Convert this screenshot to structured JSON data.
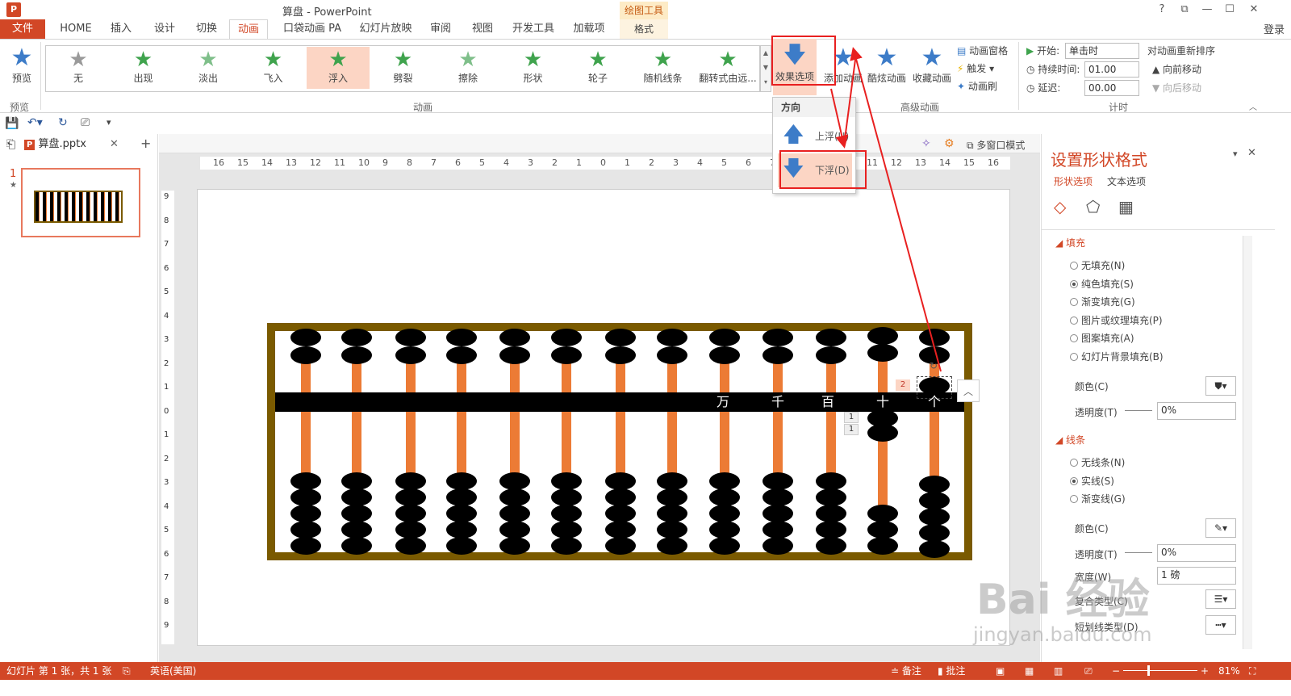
{
  "window": {
    "title": "算盘 - PowerPoint",
    "app_icon": "P",
    "help": "?",
    "restore": "⧉",
    "minimize": "—",
    "maximize": "☐",
    "close": "✕",
    "login": "登录"
  },
  "contextual": {
    "header": "绘图工具",
    "tab": "格式"
  },
  "tabs": [
    "文件",
    "HOME",
    "插入",
    "设计",
    "切换",
    "动画",
    "口袋动画 PA",
    "幻灯片放映",
    "审阅",
    "视图",
    "开发工具",
    "加载项"
  ],
  "ribbon": {
    "preview": {
      "label": "预览",
      "group": "预览"
    },
    "gallery": [
      "无",
      "出现",
      "淡出",
      "飞入",
      "浮入",
      "劈裂",
      "擦除",
      "形状",
      "轮子",
      "随机线条",
      "翻转式由远..."
    ],
    "gallery_selected": "浮入",
    "group_animation": "动画",
    "effect_options": "效果选项",
    "add_animation": "添加动画",
    "animation_painter_big": "酷炫动画",
    "collect_animation": "收藏动画",
    "animation_pane": "动画窗格",
    "trigger": "触发",
    "animation_brush": "动画刷",
    "group_advanced": "高级动画",
    "start_label": "开始:",
    "start_value": "单击时",
    "duration_label": "持续时间:",
    "duration_value": "01.00",
    "delay_label": "延迟:",
    "delay_value": "00.00",
    "reorder_title": "对动画重新排序",
    "move_earlier": "向前移动",
    "move_later": "向后移动",
    "group_timing": "计时"
  },
  "dropdown": {
    "header": "方向",
    "up": "上浮(U)",
    "down": "下浮(D)"
  },
  "file_tab": {
    "name": "算盘.pptx",
    "close": "✕",
    "add": "+"
  },
  "multiwindow": "多窗口模式",
  "slide_pane": {
    "number": "1",
    "star": "★"
  },
  "ruler_h": [
    "16",
    "15",
    "14",
    "13",
    "12",
    "11",
    "10",
    "9",
    "8",
    "7",
    "6",
    "5",
    "4",
    "3",
    "2",
    "1",
    "0",
    "1",
    "2",
    "3",
    "4",
    "5",
    "6",
    "7",
    "8",
    "9",
    "10",
    "11",
    "12",
    "13",
    "14",
    "15",
    "16"
  ],
  "ruler_v": [
    "9",
    "8",
    "7",
    "6",
    "5",
    "4",
    "3",
    "2",
    "1",
    "0",
    "1",
    "2",
    "3",
    "4",
    "5",
    "6",
    "7",
    "8",
    "9"
  ],
  "abacus": {
    "digits": [
      "万",
      "千",
      "百",
      "十",
      "个"
    ],
    "anim_tag_selected": "2",
    "anim_tags": [
      "1",
      "1"
    ],
    "collapse": "︿"
  },
  "format_pane": {
    "title": "设置形状格式",
    "tabs": [
      "形状选项",
      "文本选项"
    ],
    "fill_header": "填充",
    "fill_options": [
      "无填充(N)",
      "纯色填充(S)",
      "渐变填充(G)",
      "图片或纹理填充(P)",
      "图案填充(A)",
      "幻灯片背景填充(B)"
    ],
    "fill_selected": "纯色填充(S)",
    "color_label": "颜色(C)",
    "transparency_label": "透明度(T)",
    "transparency_value": "0%",
    "line_header": "线条",
    "line_options": [
      "无线条(N)",
      "实线(S)",
      "渐变线(G)"
    ],
    "line_selected": "实线(S)",
    "line_color_label": "颜色(C)",
    "line_transparency_label": "透明度(T)",
    "line_transparency_value": "0%",
    "width_label": "宽度(W)",
    "width_value": "1 磅",
    "compound_label": "复合类型(C)",
    "dash_label": "短划线类型(D)",
    "pin": "▾",
    "close": "✕"
  },
  "status": {
    "slide": "幻灯片 第 1 张，共 1 张",
    "language": "英语(美国)",
    "notes": "备注",
    "comments": "批注",
    "zoom": "81%",
    "zoom_minus": "−",
    "zoom_plus": "+"
  },
  "watermark": {
    "main": "Bai 经验",
    "sub": "jingyan.baidu.com"
  },
  "colors": {
    "accent": "#d24726",
    "selected_bg": "#fcd5c4",
    "bead": "#000000",
    "rod": "#ec7b35",
    "frame": "#7a5a00",
    "highlight_box": "#e82020",
    "star_blue": "#3d7cc8",
    "star_green": "#3fa34d"
  }
}
